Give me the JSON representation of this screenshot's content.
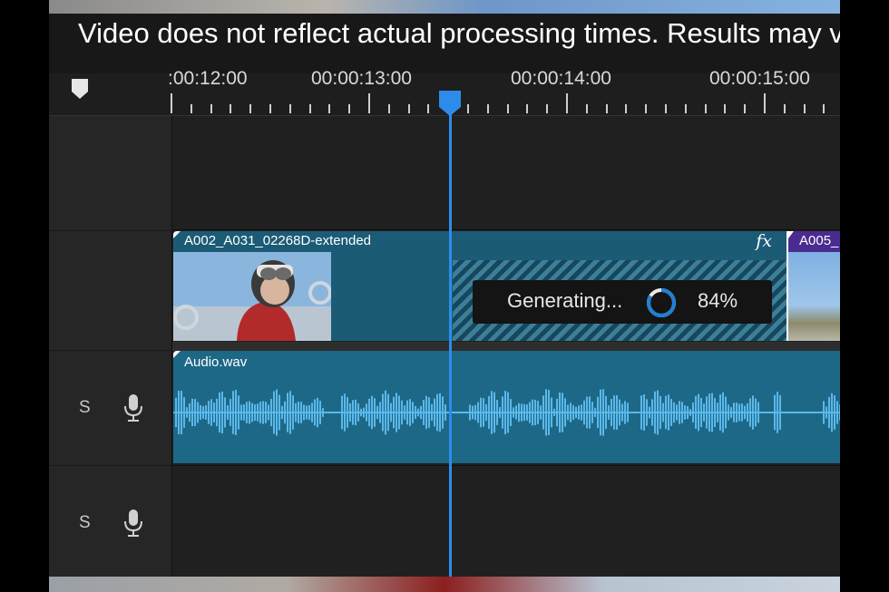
{
  "caption": "Video does not reflect actual processing times. Results may vary",
  "ruler": {
    "timecodes": [
      ":00:12:00",
      "00:00:13:00",
      "00:00:14:00",
      "00:00:15:00"
    ]
  },
  "tracks": [
    {
      "solo_label": "",
      "mic_icon": ""
    },
    {
      "solo_label": "",
      "mic_icon": ""
    },
    {
      "solo_label": "S",
      "mic_icon": "microphone-icon"
    },
    {
      "solo_label": "S",
      "mic_icon": "microphone-icon"
    }
  ],
  "video_clip": {
    "name": "A002_A031_02268D-extended",
    "fx_label": "fx",
    "generating": {
      "label": "Generating...",
      "percent": "84%",
      "progress": 0.84
    }
  },
  "next_clip": {
    "name": "A005_"
  },
  "audio_clip": {
    "name": "Audio.wav"
  },
  "colors": {
    "accent": "#2d8ceb",
    "video_clip": "#1b5b76",
    "audio_clip": "#1e6887",
    "waveform": "#5ab8ea",
    "next_clip": "#4a2b8f"
  }
}
